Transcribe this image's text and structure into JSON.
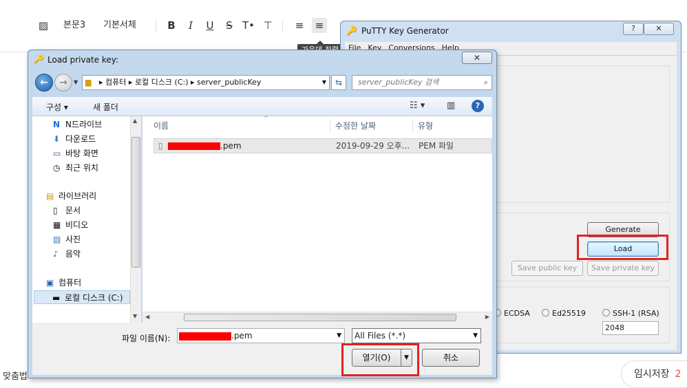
{
  "editor": {
    "toolbar": {
      "paragraph_style": "본문3",
      "font": "기본서체",
      "tooltip": "가운데 정렬"
    },
    "bottom_left_text": "맞춤법",
    "temp_save_label": "임시저장",
    "temp_save_count": "2"
  },
  "putty": {
    "title": "PuTTY Key Generator",
    "help_btn": "?",
    "close_btn": "✕",
    "menu": [
      "File",
      "Key",
      "Conversions",
      "Help"
    ],
    "buttons": {
      "generate": "Generate",
      "load": "Load",
      "save_public": "Save public key",
      "save_private": "Save private key"
    },
    "key_types": [
      "ECDSA",
      "Ed25519",
      "SSH-1 (RSA)"
    ],
    "bits_value": "2048"
  },
  "dialog": {
    "title": "Load private key:",
    "close_btn": "✕",
    "breadcrumb": [
      "컴퓨터",
      "로컬 디스크 (C:)",
      "server_publicKey"
    ],
    "search_placeholder": "server_publicKey 검색",
    "commands": {
      "organize": "구성 ▾",
      "new_folder": "새 폴더"
    },
    "nav_items": [
      {
        "label": "N드라이브",
        "icon": "N"
      },
      {
        "label": "다운로드",
        "icon": "⬇"
      },
      {
        "label": "바탕 화면",
        "icon": "▭"
      },
      {
        "label": "최근 위치",
        "icon": "◷"
      },
      {
        "label": "라이브러리",
        "icon": "▤"
      },
      {
        "label": "문서",
        "icon": "▯"
      },
      {
        "label": "비디오",
        "icon": "▦"
      },
      {
        "label": "사진",
        "icon": "▨"
      },
      {
        "label": "음악",
        "icon": "♪"
      },
      {
        "label": "컴퓨터",
        "icon": "▣"
      },
      {
        "label": "로컬 디스크 (C:)",
        "icon": "▬"
      }
    ],
    "columns": {
      "name": "이름",
      "modified": "수정한 날짜",
      "type": "유형"
    },
    "files": [
      {
        "name_suffix": ".pem",
        "modified": "2019-09-29 오후...",
        "type": "PEM 파일"
      }
    ],
    "filename_label": "파일 이름(N):",
    "filename_suffix": ".pem",
    "filter": "All Files (*.*)",
    "open_btn": "열기(O)",
    "cancel_btn": "취소"
  }
}
